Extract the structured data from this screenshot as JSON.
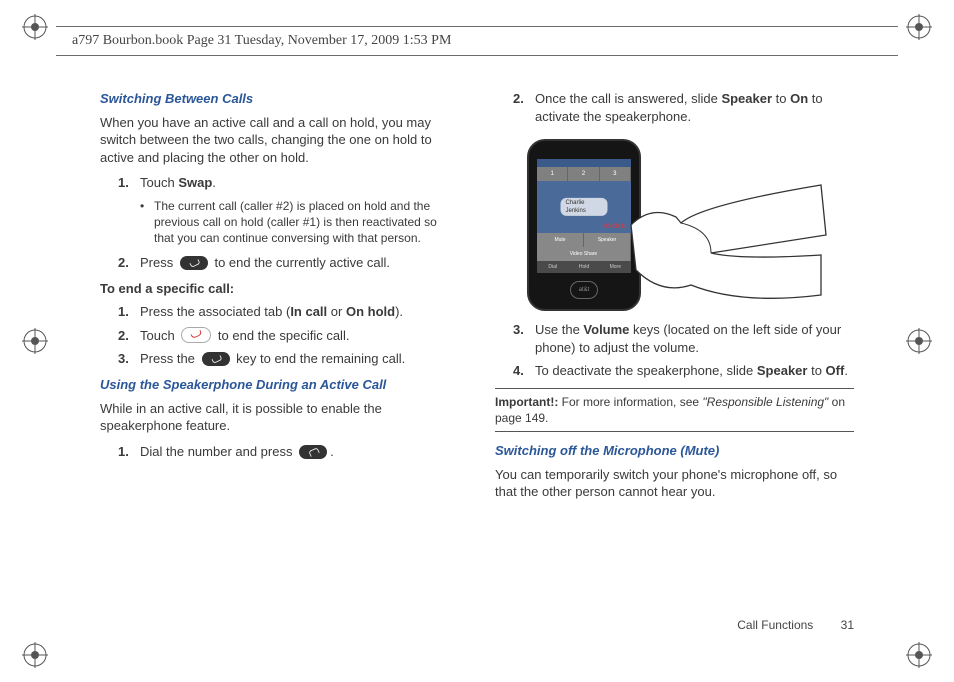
{
  "meta": {
    "header": "a797 Bourbon.book  Page 31  Tuesday, November 17, 2009  1:53 PM"
  },
  "left": {
    "sec1_title": "Switching Between Calls",
    "sec1_intro": "When you have an active call and a call on hold, you may switch between the two calls, changing the one on hold to active and placing the other on hold.",
    "s1_n1_a": "Touch ",
    "s1_n1_b": "Swap",
    "s1_n1_c": ".",
    "s1_bullet": "The current call (caller #2) is placed on hold and the previous call on hold (caller #1) is then reactivated so that you can continue conversing with that person.",
    "s1_n2_a": "Press ",
    "s1_n2_b": " to end the currently active call.",
    "sub_title": "To end a specific call:",
    "sub_n1_a": "Press the associated tab (",
    "sub_n1_b": "In call",
    "sub_n1_c": " or ",
    "sub_n1_d": "On hold",
    "sub_n1_e": ").",
    "sub_n2_a": "Touch ",
    "sub_n2_b": " to end the specific call.",
    "sub_n3_a": "Press the ",
    "sub_n3_b": " key to end the remaining call.",
    "sec2_title": "Using the Speakerphone During an Active Call",
    "sec2_intro": "While in an active call, it is possible to enable the speakerphone feature.",
    "s2_n1_a": "Dial the number and press ",
    "s2_n1_b": "."
  },
  "right": {
    "n2_a": "Once the call is answered, slide ",
    "n2_b": "Speaker",
    "n2_c": " to ",
    "n2_d": "On",
    "n2_e": " to activate the speakerphone.",
    "n3_a": "Use the ",
    "n3_b": "Volume",
    "n3_c": " keys (located on the left side of your phone) to adjust the volume.",
    "n4_a": "To deactivate the speakerphone, slide ",
    "n4_b": "Speaker",
    "n4_c": " to ",
    "n4_d": "Off",
    "n4_e": ".",
    "imp_a": "Important!:",
    "imp_b": " For more information, see ",
    "imp_c": "\"Responsible Listening\"",
    "imp_d": " on page 149.",
    "sec3_title": "Switching off the Microphone (Mute)",
    "sec3_intro": "You can temporarily switch your phone's microphone off, so that the other person cannot hear you."
  },
  "phone": {
    "tab1": "1",
    "tab2": "2",
    "tab3": "3",
    "main_label": "Charlie Jenkins",
    "timer": "00:00:11",
    "row_mute": "Mute",
    "row_spk": "Speaker",
    "row_vs": "Video Share",
    "bot1": "Dial",
    "bot2": "Hold",
    "bot3": "More",
    "carrier": "at&t"
  },
  "footer": {
    "section": "Call Functions",
    "page": "31"
  }
}
